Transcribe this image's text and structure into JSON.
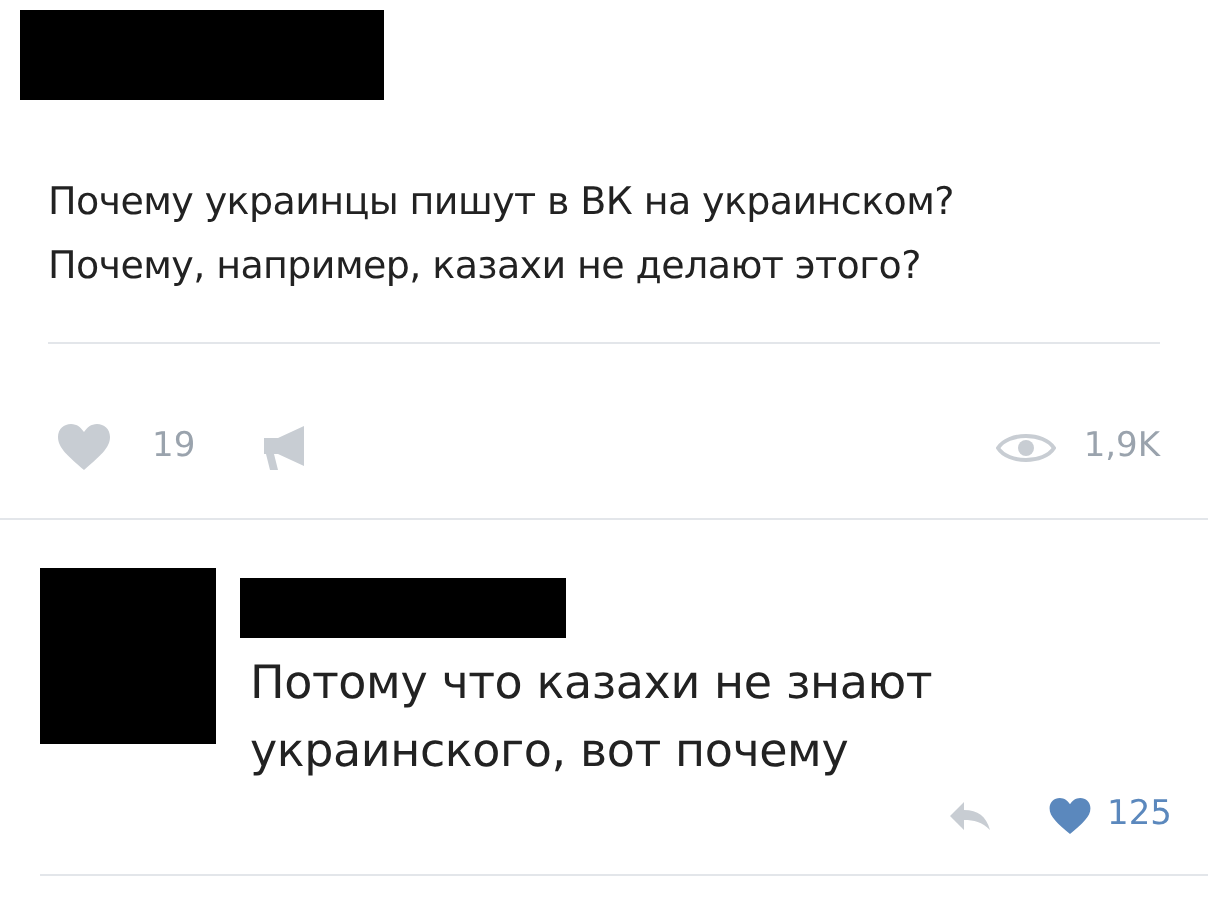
{
  "post": {
    "lines": [
      "Почему украинцы пишут в ВК на украинском?",
      "Почему, например, казахи не делают этого?"
    ],
    "likes": "19",
    "liked": false,
    "views": "1,9K"
  },
  "comment": {
    "lines": [
      "Потому что казахи не знают",
      "украинского, вот почему"
    ],
    "likes": "125",
    "liked": true
  }
}
